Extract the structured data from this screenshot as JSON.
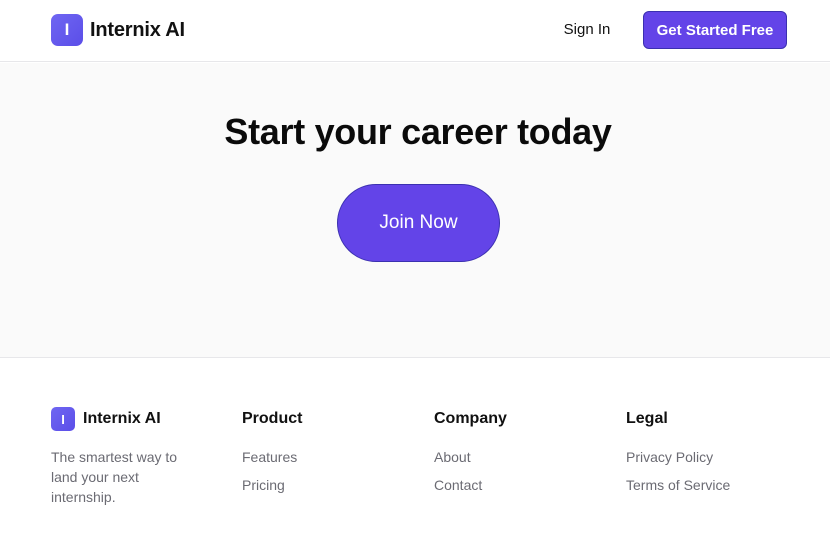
{
  "brand": {
    "initial": "I",
    "name": "Internix AI"
  },
  "header": {
    "signin_label": "Sign In",
    "cta_label": "Get Started Free"
  },
  "hero": {
    "title": "Start your career today",
    "button_label": "Join Now"
  },
  "footer": {
    "tagline": "The smartest way to land your next internship.",
    "columns": [
      {
        "heading": "Product",
        "links": [
          "Features",
          "Pricing"
        ]
      },
      {
        "heading": "Company",
        "links": [
          "About",
          "Contact"
        ]
      },
      {
        "heading": "Legal",
        "links": [
          "Privacy Policy",
          "Terms of Service"
        ]
      }
    ]
  },
  "colors": {
    "accent": "#6344e8",
    "hero_bg": "#fafafa",
    "muted_text": "#6b6b73"
  }
}
